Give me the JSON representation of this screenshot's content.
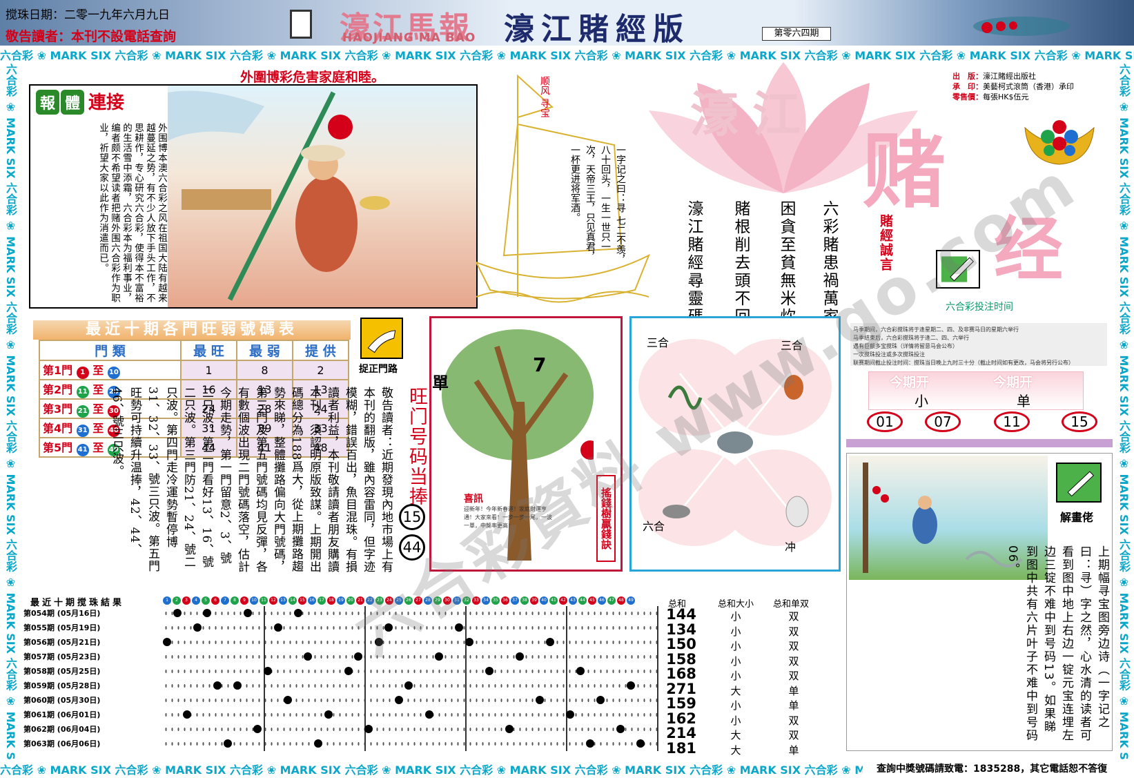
{
  "header": {
    "draw_date": "搅珠日期：二零一九年六月九日",
    "notice": "敬告讀者：本刊不設電話查詢",
    "masthead_cn": "濠江馬報",
    "masthead_en": "HAOJIANG MA BAO",
    "edition": "濠江賭經版",
    "issue": "第零六四期"
  },
  "band_text": "六合彩 ❀ MARK SIX 六合彩 ❀ MARK SIX 六合彩 ❀ MARK SIX 六合彩 ❀ MARK SIX 六合彩 ❀ MARK SIX 六合彩 ❀ MARK SIX 六合彩 ❀ MARK SIX 六合彩 ❀ MARK SIX 六合彩 ❀ MARK SIX 六合彩 ❀ MARK SIX",
  "footer_contact": "查詢中獎號碼請致電：1835288，其它電話恕不答復",
  "headline": "外圍博彩危害家庭和睦。",
  "comic": {
    "tags": [
      "報",
      "體",
      "連接"
    ],
    "text": "外围博本澳六合彩之风在祖国大陆有越来越蔓延之势，有不少人放下手头工作，不思耕作，专心研究六合彩，使得本不富裕的生活雪中添霜，六合彩本为福利事业，编者颇不希望读者把赌外围六合彩作为职业，祈望大家以此作为消遣而已。"
  },
  "boat": {
    "sail": "顺风 寻宝",
    "poem": "一字记之曰：寻 七二不羡，八十回头，一生一世只一次，天帝三王，只见真君，一杯更进将军酒。"
  },
  "verses": [
    "六彩賭患禍萬家",
    "困貪至貧無米炊",
    "賭根削去頭不回",
    "濠江賭經尋靈碼"
  ],
  "verse_caption": "賭經誠言",
  "logo": {
    "part1": "濠江",
    "part2": "赌",
    "part3": "经"
  },
  "publisher": {
    "lines": [
      {
        "k": "出　版：",
        "v": "濠江賭經出版社"
      },
      {
        "k": "承　印：",
        "v": "美藝柯式滾筒（香港）承印"
      },
      {
        "k": "零售價：",
        "v": "每張HK$伍元"
      }
    ]
  },
  "bet_time": {
    "title": "六合彩投注时间",
    "lines": [
      "马季期间，六合彩搅珠将于逢星期二、四、及非赛马日的星期六举行",
      "马季结束后，六合彩搅珠将于逢二、四、六举行",
      "遇有巨额多宝搅珠（详情将留意马会公布）",
      "一次搅珠投注或多次搅珠投注",
      "联赛期间截止投注时间：搅珠当日晚上九时三十分（截止时间如有更改，马会将另行公布）"
    ]
  },
  "this_period": {
    "label": "今期开",
    "size": "小",
    "odd": "单",
    "picks": [
      "01",
      "07",
      "11",
      "15"
    ]
  },
  "hot_table": {
    "title": "最近十期各門旺弱號碼表",
    "headers": [
      "門 類",
      "最 旺",
      "最 弱",
      "提 供"
    ],
    "rows": [
      {
        "door": "第1門",
        "from": "1",
        "to": "10",
        "hot": "1",
        "weak": "8",
        "tip": "2"
      },
      {
        "door": "第2門",
        "from": "11",
        "to": "20",
        "hot": "16",
        "weak": "13",
        "tip": "13"
      },
      {
        "door": "第3門",
        "from": "21",
        "to": "30",
        "hot": "24",
        "weak": "28",
        "tip": "24"
      },
      {
        "door": "第4門",
        "from": "31",
        "to": "40",
        "hot": "31",
        "weak": "39",
        "tip": "33"
      },
      {
        "door": "第5門",
        "from": "41",
        "to": "49",
        "hot": "44",
        "weak": "41",
        "tip": "48"
      }
    ],
    "to_word": "至"
  },
  "catch_door": {
    "label": "捉正門路",
    "title": "旺门号码当捧",
    "numbers": [
      "15",
      "44"
    ]
  },
  "body_text": "敬告讀者：近期發現內地市場上有本刊的翻版，雖內容雷同，但字迹模糊，錯誤百出，魚目混珠。有損讀者利益，本刊敬請讀者朋友購讀本刊，須認明原版致謀。上期開出碼總分為188爲大，從上期攤路趨勢來睇，整體攤路偏向大門號碼，第三門及第五門號碼均見反彈，各有數個波出現二門號碼落空，估計今期走勢，第一門留意2、3、號二只波。第二門看好13、16、號二只波。第三門防21、24、號二只波。第四門走冷運勢暫停博31、32、33、號三只波。第五門旺勢可持續升温捧，42、44、46、號三只波。",
  "tree": {
    "single": "單",
    "seven": "7",
    "caption": "搖錢樹贏錢訣",
    "news_title": "喜訊",
    "news": "迎新年！今年新春運！家庭財運亨通！大家來看！一步一步一尾，一波一單，中獎率更高！"
  },
  "zodiac": {
    "tl": "三合",
    "tr": "三合",
    "bl": "六合",
    "br": "冲"
  },
  "results": {
    "title": "最近十期搅珠結果",
    "col_sum": "总和",
    "col_size": "总和大小",
    "col_odd": "总和单双",
    "rows": [
      {
        "period": "第054期",
        "date": "(05月16日)",
        "sum": "144",
        "size": "小",
        "odd": "双"
      },
      {
        "period": "第055期",
        "date": "(05月19日)",
        "sum": "134",
        "size": "小",
        "odd": "双"
      },
      {
        "period": "第056期",
        "date": "(05月21日)",
        "sum": "150",
        "size": "小",
        "odd": "双"
      },
      {
        "period": "第057期",
        "date": "(05月23日)",
        "sum": "158",
        "size": "小",
        "odd": "双"
      },
      {
        "period": "第058期",
        "date": "(05月25日)",
        "sum": "168",
        "size": "小",
        "odd": "双"
      },
      {
        "period": "第059期",
        "date": "(05月28日)",
        "sum": "271",
        "size": "大",
        "odd": "单"
      },
      {
        "period": "第060期",
        "date": "(05月30日)",
        "sum": "159",
        "size": "小",
        "odd": "单"
      },
      {
        "period": "第061期",
        "date": "(06月01日)",
        "sum": "162",
        "size": "小",
        "odd": "双"
      },
      {
        "period": "第062期",
        "date": "(06月04日)",
        "sum": "214",
        "size": "大",
        "odd": "双"
      },
      {
        "period": "第063期",
        "date": "(06月06日)",
        "sum": "181",
        "size": "大",
        "odd": "单"
      }
    ]
  },
  "riddle": {
    "label": "解畫佬",
    "text": "上期幅寻宝图旁边诗（一字记之曰：寻）字之然，心水清的读者可看到图中地上右边一锭元宝连埋左边三锭不难中到号码13。如果睇到图中共有六片叶子不难中到号码06。"
  },
  "watermark": "六合彩資料 www.go.com",
  "colors": {
    "accent_red": "#d4001a",
    "cyan": "#0aa7c9",
    "tree_border": "#c0163b",
    "zodiac_border": "#27a4d8"
  }
}
